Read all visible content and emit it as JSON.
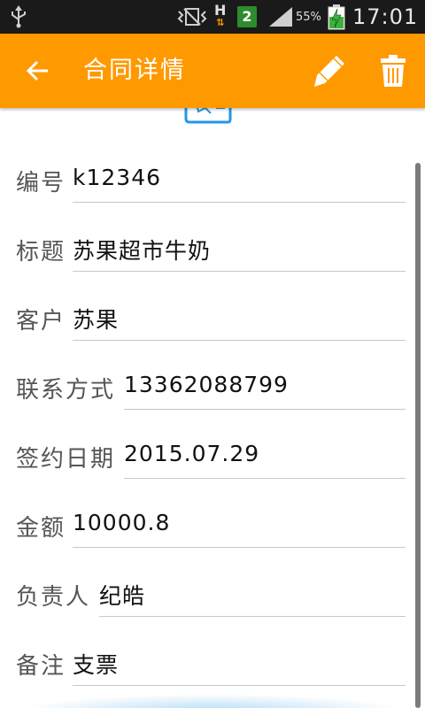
{
  "status_bar": {
    "network_type": "H",
    "sim_slot": "2",
    "battery_percent": "55%",
    "time": "17:01"
  },
  "action_bar": {
    "title": "合同详情",
    "background_color": "#ff9900",
    "icons": {
      "back": "arrow-left-icon",
      "edit": "pencil-icon",
      "delete": "trash-icon"
    }
  },
  "fields": [
    {
      "label": "编号",
      "value": "k12346"
    },
    {
      "label": "标题",
      "value": "苏果超市牛奶"
    },
    {
      "label": "客户",
      "value": "苏果"
    },
    {
      "label": "联系方式",
      "value": "13362088799"
    },
    {
      "label": "签约日期",
      "value": "2015.07.29"
    },
    {
      "label": "金额",
      "value": "10000.8"
    },
    {
      "label": "负责人",
      "value": "纪皓"
    },
    {
      "label": "备注",
      "value": "支票"
    }
  ]
}
